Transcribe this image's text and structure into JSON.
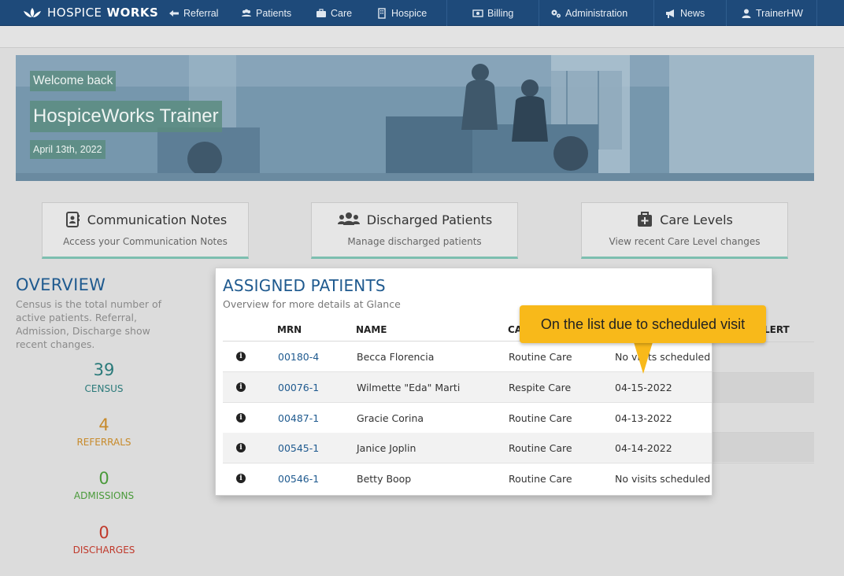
{
  "nav": {
    "brand_light": "HOSPICE",
    "brand_bold": "WORKS",
    "items": [
      {
        "label": "Referral",
        "icon": "referral-icon"
      },
      {
        "label": "Patients",
        "icon": "patients-icon"
      },
      {
        "label": "Care",
        "icon": "briefcase-icon"
      },
      {
        "label": "Hospice",
        "icon": "building-icon"
      },
      {
        "label": "Billing",
        "icon": "money-icon"
      },
      {
        "label": "Administration",
        "icon": "cogs-icon"
      },
      {
        "label": "News",
        "icon": "megaphone-icon"
      },
      {
        "label": "TrainerHW",
        "icon": "user-icon"
      }
    ]
  },
  "hero": {
    "welcome": "Welcome back",
    "name": "HospiceWorks Trainer",
    "date": "April 13th, 2022"
  },
  "cards": [
    {
      "title": "Communication Notes",
      "subtitle": "Access your Communication Notes",
      "icon": "address-book-icon"
    },
    {
      "title": "Discharged Patients",
      "subtitle": "Manage discharged patients",
      "icon": "users-icon"
    },
    {
      "title": "Care Levels",
      "subtitle": "View recent Care Level changes",
      "icon": "medkit-icon"
    }
  ],
  "overview": {
    "title": "OVERVIEW",
    "description": "Census is the total number of active patients. Referral, Admission, Discharge show recent changes.",
    "stats": [
      {
        "value": "39",
        "label": "CENSUS",
        "color": "#2a7a7a"
      },
      {
        "value": "4",
        "label": "REFERRALS",
        "color": "#c78a2a"
      },
      {
        "value": "0",
        "label": "ADMISSIONS",
        "color": "#4a9a3a"
      },
      {
        "value": "0",
        "label": "DISCHARGES",
        "color": "#c0392b"
      }
    ]
  },
  "assigned": {
    "title": "ASSIGNED PATIENTS",
    "subtitle": "Overview for more details at Glance",
    "columns": {
      "mrn": "MRN",
      "name": "NAME",
      "care": "CA",
      "alert": "LERT"
    },
    "rows": [
      {
        "mrn": "00180-4",
        "name": "Becca Florencia",
        "care": "Routine Care",
        "visit": "No visits scheduled"
      },
      {
        "mrn": "00076-1",
        "name": "Wilmette \"Eda\" Marti",
        "care": "Respite Care",
        "visit": "04-15-2022"
      },
      {
        "mrn": "00487-1",
        "name": "Gracie Corina",
        "care": "Routine Care",
        "visit": "04-13-2022"
      },
      {
        "mrn": "00545-1",
        "name": "Janice Joplin",
        "care": "Routine Care",
        "visit": "04-14-2022"
      },
      {
        "mrn": "00546-1",
        "name": "Betty Boop",
        "care": "Routine Care",
        "visit": "No visits scheduled"
      }
    ]
  },
  "tooltip": {
    "text": "On the list due to scheduled visit"
  }
}
